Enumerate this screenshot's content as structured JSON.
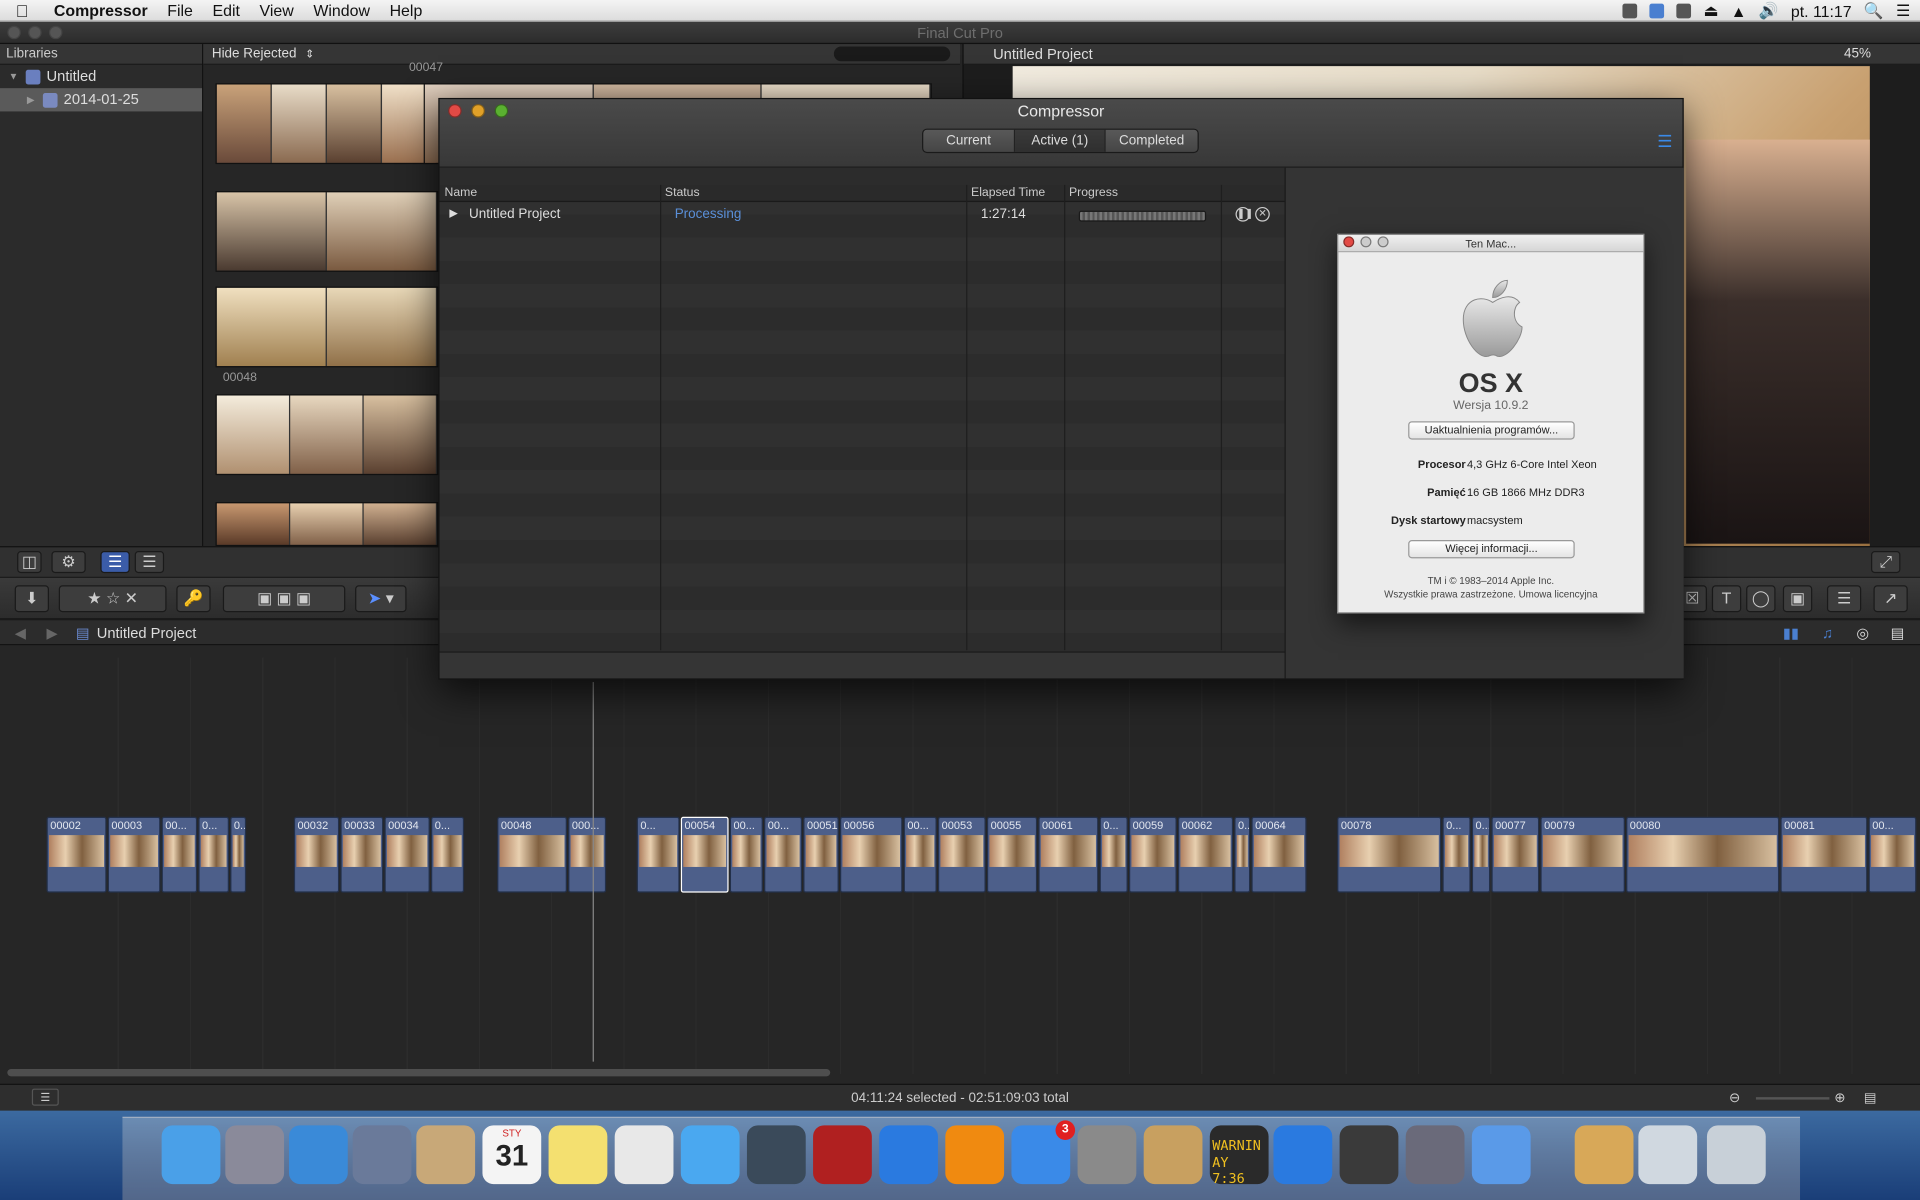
{
  "menubar": {
    "app": "Compressor",
    "items": [
      "File",
      "Edit",
      "View",
      "Window",
      "Help"
    ],
    "clock": "pt. 11:17"
  },
  "fcp": {
    "window_title": "Final Cut Pro",
    "libraries_label": "Libraries",
    "library_name": "Untitled",
    "event_name": "2014-01-25",
    "filter_label": "Hide Rejected",
    "clip_label_top": "00047",
    "clip_label_mid": "00048",
    "viewer_title": "Untitled Project",
    "viewer_zoom": "45%",
    "timeline_title": "Untitled Project",
    "status": "04:11:24 selected - 02:51:09:03 total"
  },
  "timeline_clips": [
    {
      "label": "00002"
    },
    {
      "label": "00003"
    },
    {
      "label": "00..."
    },
    {
      "label": "0..."
    },
    {
      "label": "0..."
    },
    {
      "label": "00032"
    },
    {
      "label": "00033"
    },
    {
      "label": "00034"
    },
    {
      "label": "0..."
    },
    {
      "label": "00048"
    },
    {
      "label": "000..."
    },
    {
      "label": "0..."
    },
    {
      "label": "00054"
    },
    {
      "label": "00..."
    },
    {
      "label": "00..."
    },
    {
      "label": "00051"
    },
    {
      "label": "00056"
    },
    {
      "label": "00..."
    },
    {
      "label": "00053"
    },
    {
      "label": "00055"
    },
    {
      "label": "00061"
    },
    {
      "label": "0..."
    },
    {
      "label": "00059"
    },
    {
      "label": "00062"
    },
    {
      "label": "0..."
    },
    {
      "label": "00064"
    },
    {
      "label": "00078"
    },
    {
      "label": "0..."
    },
    {
      "label": "0..."
    },
    {
      "label": "00077"
    },
    {
      "label": "00079"
    },
    {
      "label": "00080"
    },
    {
      "label": "00081"
    },
    {
      "label": "00..."
    }
  ],
  "compressor": {
    "title": "Compressor",
    "tabs": [
      "Current",
      "Active (1)",
      "Completed"
    ],
    "active_tab": "Active (1)",
    "columns": [
      "Name",
      "Status",
      "Elapsed Time",
      "Progress"
    ],
    "job": {
      "name": "Untitled Project",
      "status": "Processing",
      "elapsed": "1:27:14"
    },
    "status_color": "#5a8fd8"
  },
  "about": {
    "title": "Ten Mac...",
    "os_name": "OS X",
    "version": "Wersja 10.9.2",
    "update_button": "Uaktualnienia programów...",
    "specs": [
      {
        "key": "Procesor",
        "value": "4,3 GHz 6-Core Intel Xeon"
      },
      {
        "key": "Pamięć",
        "value": "16 GB 1866 MHz DDR3"
      },
      {
        "key": "Dysk startowy",
        "value": "macsystem"
      }
    ],
    "more_button": "Więcej informacji...",
    "copyright_1": "TM i © 1983–2014 Apple Inc.",
    "copyright_2": "Wszystkie prawa zastrzeżone.  Umowa licencyjna"
  },
  "dock": {
    "icons": [
      "finder-icon",
      "launchpad-icon",
      "safari-icon",
      "mail-icon",
      "contacts-icon",
      "calendar-icon",
      "notes-icon",
      "reminders-icon",
      "messages-icon",
      "facetime-icon",
      "photo-booth-icon",
      "itunes-icon",
      "ibooks-icon",
      "app-store-icon",
      "system-preferences-icon",
      "archive-utility-icon",
      "console-icon",
      "teamviewer-icon",
      "final-cut-pro-icon",
      "compressor-icon",
      "automator-icon",
      "downloads-stack-icon",
      "documents-stack-icon",
      "trash-icon"
    ],
    "calendar_month": "STY",
    "calendar_day": "31",
    "app_store_badge": "3",
    "console_text_1": "WARNIN",
    "console_text_2": "AY 7:36"
  }
}
